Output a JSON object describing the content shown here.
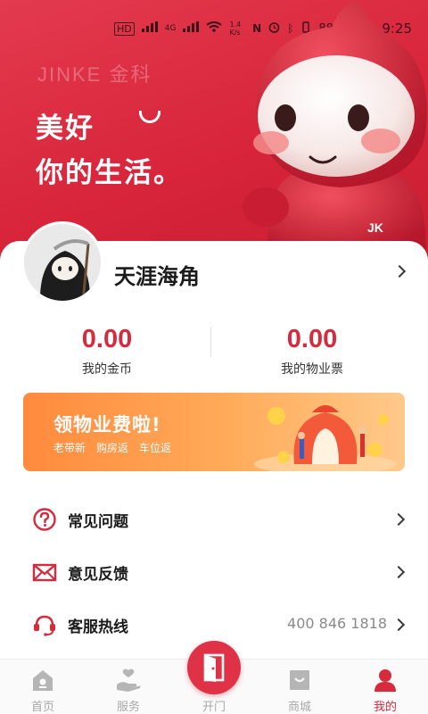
{
  "status_bar": {
    "network": "4G",
    "speed": "1.4\nK/s",
    "battery": "88%",
    "time": "9:25"
  },
  "hero": {
    "brand": "JINKE 金科",
    "slogan_line1": "美好",
    "slogan_line2": "你的生活。",
    "mascot_badge": "JK",
    "background_color": "#d8253b"
  },
  "profile": {
    "username": "天涯海角"
  },
  "stats": [
    {
      "value": "0.00",
      "label": "我的金币"
    },
    {
      "value": "0.00",
      "label": "我的物业票"
    }
  ],
  "banner": {
    "title": "领物业费啦!",
    "tags": [
      "老带新",
      "购房返",
      "车位返"
    ]
  },
  "menu": [
    {
      "label": "常见问题",
      "icon": "question-icon",
      "value": ""
    },
    {
      "label": "意见反馈",
      "icon": "mail-icon",
      "value": ""
    },
    {
      "label": "客服热线",
      "icon": "headset-icon",
      "value": "400 846 1818"
    }
  ],
  "nav": [
    {
      "label": "首页",
      "icon": "home-icon",
      "active": false
    },
    {
      "label": "服务",
      "icon": "service-hand-icon",
      "active": false
    },
    {
      "label": "开门",
      "icon": "door-icon",
      "active": false
    },
    {
      "label": "商城",
      "icon": "shop-bag-icon",
      "active": false
    },
    {
      "label": "我的",
      "icon": "user-icon",
      "active": true
    }
  ],
  "colors": {
    "accent": "#d62a3d",
    "banner_orange": "#ff8a3d",
    "inactive_nav": "#a8a8a8"
  }
}
